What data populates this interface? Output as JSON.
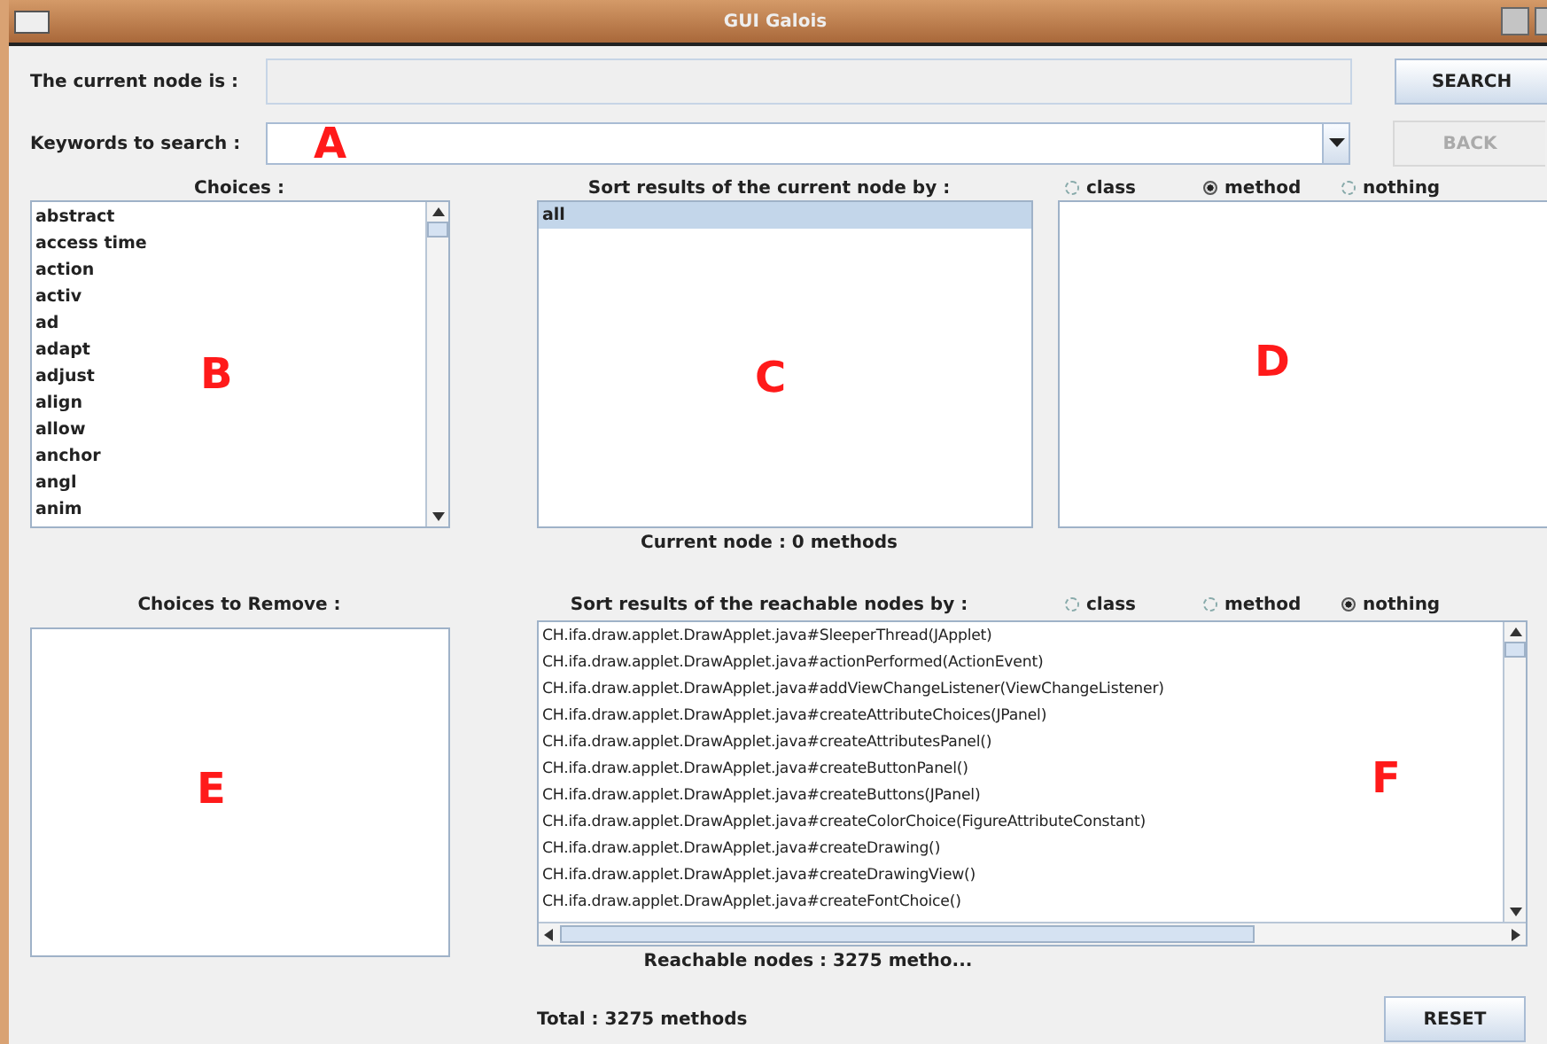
{
  "window": {
    "title": "GUI Galois"
  },
  "current_node": {
    "label": "The current node is :"
  },
  "keywords": {
    "label": "Keywords to search :"
  },
  "buttons": [
    {
      "label": "SEARCH",
      "disabled": false
    },
    {
      "label": "BACK",
      "disabled": true
    }
  ],
  "choices": {
    "title": "Choices :",
    "items": [
      {
        "label": "abstract",
        "selected": false
      },
      {
        "label": "access time",
        "selected": false
      },
      {
        "label": "action",
        "selected": false
      },
      {
        "label": "activ",
        "selected": false
      },
      {
        "label": "ad",
        "selected": false
      },
      {
        "label": "adapt",
        "selected": false
      },
      {
        "label": "adjust",
        "selected": false
      },
      {
        "label": "align",
        "selected": false
      },
      {
        "label": "allow",
        "selected": false
      },
      {
        "label": "anchor",
        "selected": false
      },
      {
        "label": "angl",
        "selected": false
      },
      {
        "label": "anim",
        "selected": false
      }
    ]
  },
  "current_sort": {
    "title": "Sort results of the current node by :",
    "options": [
      {
        "label": "class",
        "selected": false
      },
      {
        "label": "method",
        "selected": true
      },
      {
        "label": "nothing",
        "selected": false
      }
    ],
    "items": [
      {
        "label": "all",
        "selected": true
      }
    ],
    "status": "Current node : 0 methods"
  },
  "choices_to_remove": {
    "title": "Choices to Remove :"
  },
  "reachable_sort": {
    "title": "Sort results of the reachable nodes by :",
    "options": [
      {
        "label": "class",
        "selected": false
      },
      {
        "label": "method",
        "selected": false
      },
      {
        "label": "nothing",
        "selected": true
      }
    ],
    "items": [
      "CH.ifa.draw.applet.DrawApplet.java#SleeperThread(JApplet)",
      "CH.ifa.draw.applet.DrawApplet.java#actionPerformed(ActionEvent)",
      "CH.ifa.draw.applet.DrawApplet.java#addViewChangeListener(ViewChangeListener)",
      "CH.ifa.draw.applet.DrawApplet.java#createAttributeChoices(JPanel)",
      "CH.ifa.draw.applet.DrawApplet.java#createAttributesPanel()",
      "CH.ifa.draw.applet.DrawApplet.java#createButtonPanel()",
      "CH.ifa.draw.applet.DrawApplet.java#createButtons(JPanel)",
      "CH.ifa.draw.applet.DrawApplet.java#createColorChoice(FigureAttributeConstant)",
      "CH.ifa.draw.applet.DrawApplet.java#createDrawing()",
      "CH.ifa.draw.applet.DrawApplet.java#createDrawingView()",
      "CH.ifa.draw.applet.DrawApplet.java#createFontChoice()"
    ],
    "status": "Reachable nodes : 3275 metho..."
  },
  "total": "Total : 3275 methods",
  "reset": {
    "label": "RESET"
  },
  "annotations": [
    "A",
    "B",
    "C",
    "D",
    "E",
    "F"
  ]
}
